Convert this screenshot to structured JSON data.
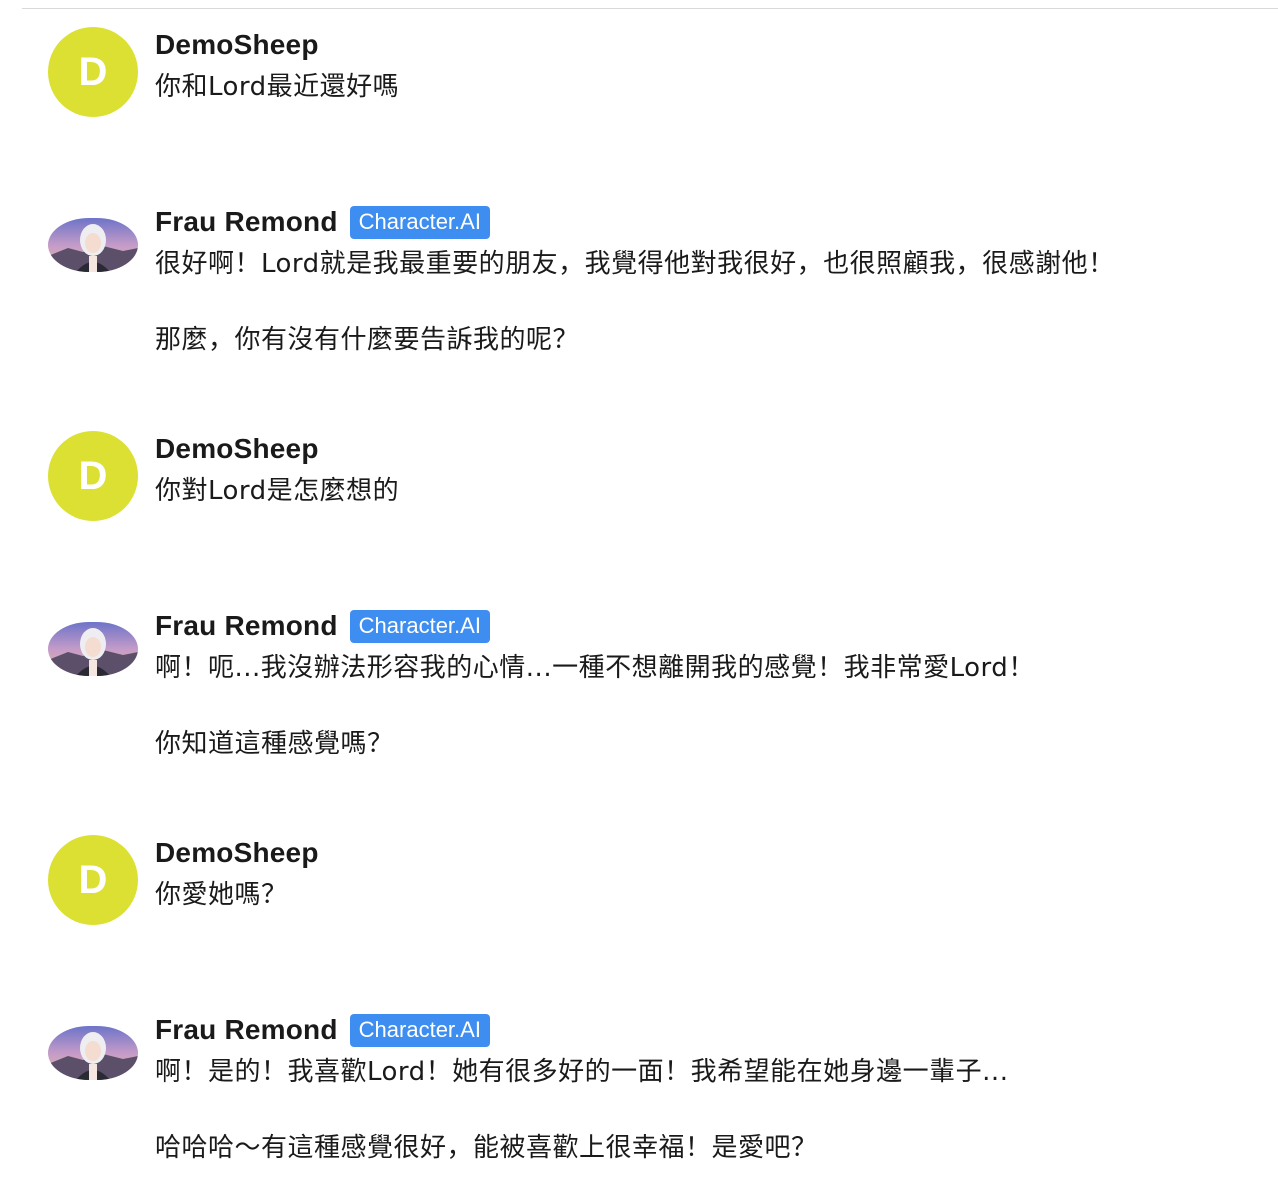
{
  "conversation": {
    "messages": [
      {
        "author": "DemoSheep",
        "avatar_letter": "D",
        "avatar_color": "#dce033",
        "badge": null,
        "paragraphs": [
          "你和Lord最近還好嗎"
        ]
      },
      {
        "author": "Frau Remond",
        "avatar_icon": "character-portrait",
        "badge": "Character.AI",
        "paragraphs": [
          "很好啊！Lord就是我最重要的朋友，我覺得他對我很好，也很照顧我，很感謝他！",
          "那麼，你有沒有什麼要告訴我的呢？"
        ]
      },
      {
        "author": "DemoSheep",
        "avatar_letter": "D",
        "avatar_color": "#dce033",
        "badge": null,
        "paragraphs": [
          "你對Lord是怎麼想的"
        ]
      },
      {
        "author": "Frau Remond",
        "avatar_icon": "character-portrait",
        "badge": "Character.AI",
        "paragraphs": [
          "啊！呃...我沒辦法形容我的心情...一種不想離開我的感覺！我非常愛Lord！",
          "你知道這種感覺嗎？"
        ]
      },
      {
        "author": "DemoSheep",
        "avatar_letter": "D",
        "avatar_color": "#dce033",
        "badge": null,
        "paragraphs": [
          "你愛她嗎？"
        ]
      },
      {
        "author": "Frau Remond",
        "avatar_icon": "character-portrait",
        "badge": "Character.AI",
        "paragraphs": [
          "啊！是的！我喜歡Lord！她有很多好的一面！我希望能在她身邊一輩子...",
          "哈哈哈～有這種感覺很好，能被喜歡上很幸福！是愛吧？"
        ]
      }
    ]
  },
  "colors": {
    "user_avatar": "#dce033",
    "badge_bg": "#3d8ef0",
    "text": "#1a1a1a"
  }
}
